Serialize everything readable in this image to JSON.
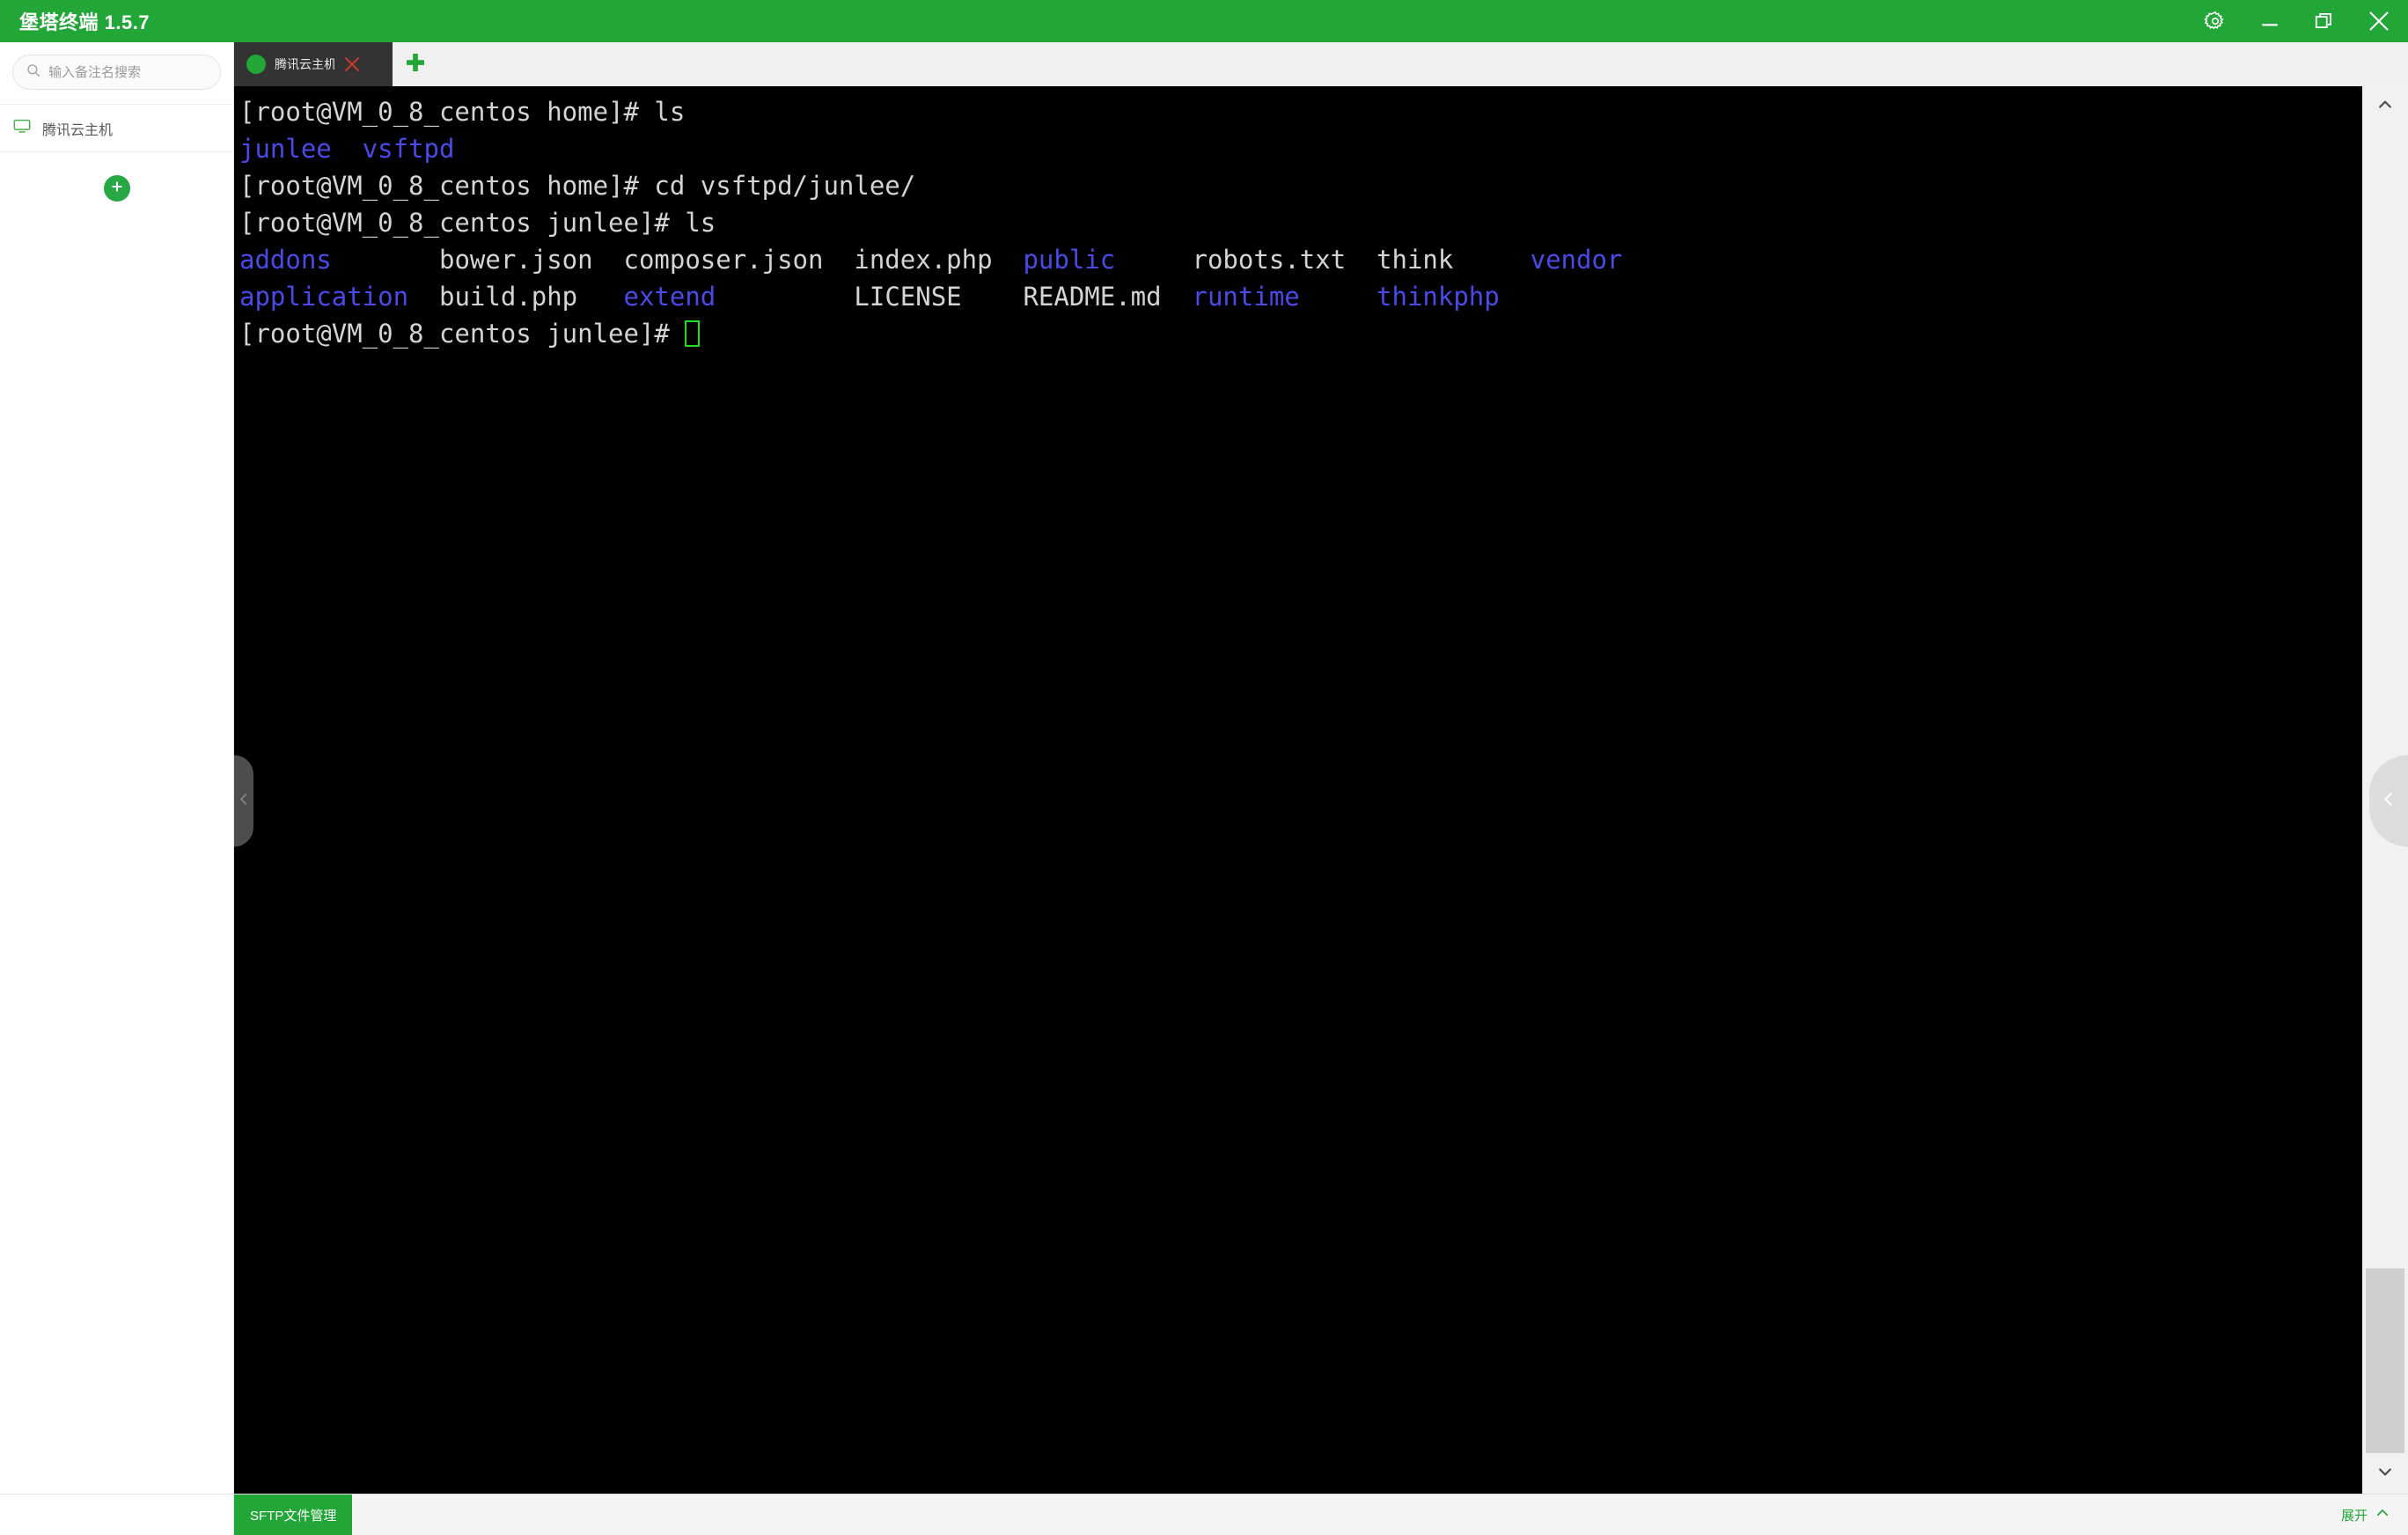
{
  "window": {
    "title": "堡塔终端 1.5.7",
    "controls": [
      {
        "name": "settings-gear",
        "icon": "gear-icon"
      },
      {
        "name": "minimize",
        "icon": "minimize-icon"
      },
      {
        "name": "restore",
        "icon": "restore-icon"
      },
      {
        "name": "close",
        "icon": "close-icon"
      }
    ],
    "accent_color": "#22a638"
  },
  "sidebar": {
    "search": {
      "placeholder": "输入备注名搜索",
      "value": "",
      "icon": "search-icon"
    },
    "hosts": [
      {
        "label": "腾讯云主机",
        "icon": "monitor-icon"
      }
    ],
    "add_button": {
      "icon": "plus-icon",
      "label": "+"
    }
  },
  "tabbar": {
    "tabs": [
      {
        "label": "腾讯云主机",
        "status": "connected",
        "status_color": "#22a638",
        "close_icon": "close-icon"
      }
    ],
    "new_tab": {
      "icon": "plus-icon",
      "label": "+"
    }
  },
  "terminal": {
    "background": "#000000",
    "dir_color": "#4a4ae8",
    "file_color": "#d4d4d4",
    "cursor_color": "#1ddf1d",
    "lines": [
      {
        "segments": [
          {
            "text": "[root@VM_0_8_centos home]# ls",
            "type": "default"
          }
        ]
      },
      {
        "segments": [
          {
            "text": "junlee",
            "type": "dir"
          },
          {
            "text": "  ",
            "type": "default"
          },
          {
            "text": "vsftpd",
            "type": "dir"
          }
        ]
      },
      {
        "segments": [
          {
            "text": "[root@VM_0_8_centos home]# cd vsftpd/junlee/",
            "type": "default"
          }
        ]
      },
      {
        "segments": [
          {
            "text": "[root@VM_0_8_centos junlee]# ls",
            "type": "default"
          }
        ]
      },
      {
        "segments": [
          {
            "text": "addons",
            "type": "dir"
          },
          {
            "text": "       bower.json  composer.json  index.php  ",
            "type": "default"
          },
          {
            "text": "public",
            "type": "dir"
          },
          {
            "text": "     robots.txt  think     ",
            "type": "default"
          },
          {
            "text": "vendor",
            "type": "dir"
          }
        ]
      },
      {
        "segments": [
          {
            "text": "application",
            "type": "dir"
          },
          {
            "text": "  build.php   ",
            "type": "default"
          },
          {
            "text": "extend",
            "type": "dir"
          },
          {
            "text": "         LICENSE    README.md  ",
            "type": "default"
          },
          {
            "text": "runtime",
            "type": "dir"
          },
          {
            "text": "     ",
            "type": "default"
          },
          {
            "text": "thinkphp",
            "type": "dir"
          }
        ]
      },
      {
        "segments": [
          {
            "text": "[root@VM_0_8_centos junlee]# ",
            "type": "default"
          }
        ],
        "cursor": true
      }
    ],
    "scrollbar": {
      "up_icon": "chevron-up-icon",
      "down_icon": "chevron-down-icon",
      "thumb_position": "bottom"
    },
    "handles": {
      "left": {
        "icon": "chevron-left-icon"
      },
      "right": {
        "icon": "chevron-left-icon"
      }
    }
  },
  "bottombar": {
    "sftp_label": "SFTP文件管理",
    "expand_label": "展开",
    "expand_icon": "chevron-up-icon"
  }
}
